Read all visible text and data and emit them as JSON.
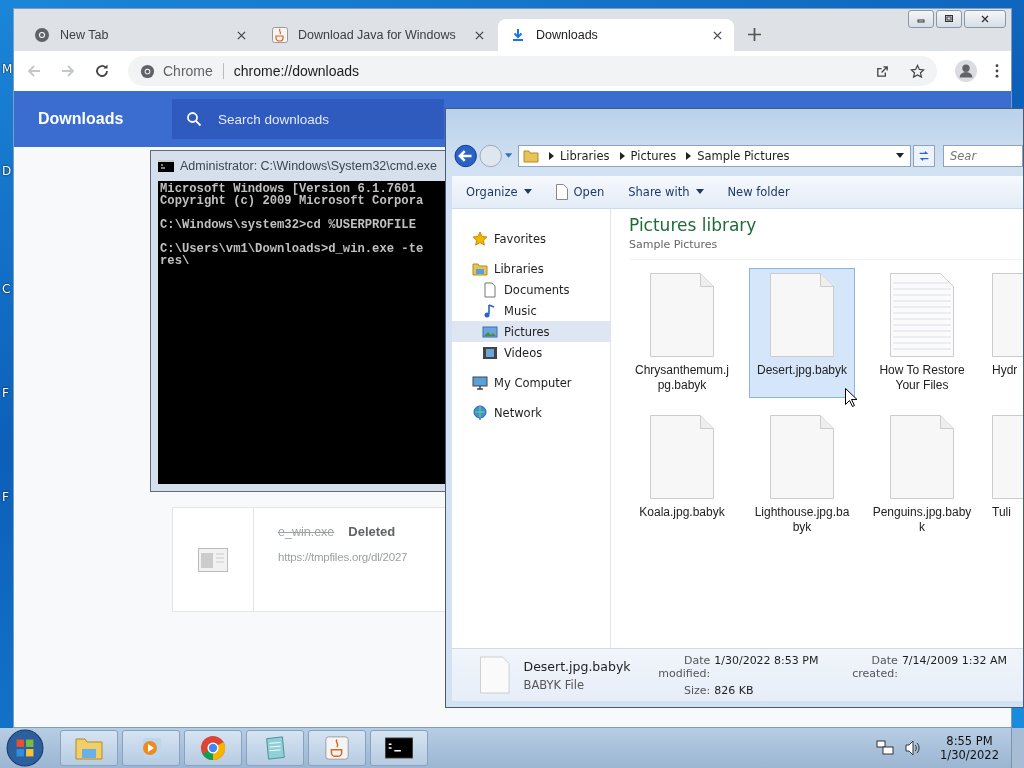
{
  "desktop": {
    "icon_labels": [
      "M",
      "D",
      "C",
      "F",
      "F"
    ]
  },
  "browser": {
    "tabs": [
      {
        "title": "New Tab",
        "kind": "chrome",
        "selected": false
      },
      {
        "title": "Download Java for Windows",
        "kind": "java",
        "selected": false
      },
      {
        "title": "Downloads",
        "kind": "download",
        "selected": true
      }
    ],
    "address": {
      "site": "Chrome",
      "url": "chrome://downloads"
    },
    "page": {
      "title": "Downloads",
      "search": {
        "placeholder": "Search downloads"
      },
      "items": [
        {
          "name": "e_win.exe",
          "deleted": true,
          "status": "Deleted",
          "url": "https://tmpfiles.org/dl/2027"
        }
      ]
    }
  },
  "console": {
    "title": "Administrator: C:\\Windows\\System32\\cmd.exe",
    "blocks": [
      [
        "Microsoft Windows [Version 6.1.7601",
        "Copyright (c) 2009 Microsoft Corpora"
      ],
      [
        "C:\\Windows\\system32>cd %USERPROFILE"
      ],
      [
        "C:\\Users\\vm1\\Downloads>d_win.exe -te",
        "res\\"
      ]
    ]
  },
  "explorer": {
    "breadcrumbs": [
      "Libraries",
      "Pictures",
      "Sample Pictures"
    ],
    "search": {
      "placeholder": "Sear"
    },
    "toolbar": [
      {
        "label": "Organize",
        "kind": "menu"
      },
      {
        "label": "Open",
        "kind": "open"
      },
      {
        "label": "Share with",
        "kind": "menu"
      },
      {
        "label": "New folder",
        "kind": "plain"
      }
    ],
    "nav": [
      {
        "label": "Favorites",
        "kind": "star",
        "selected": false
      },
      {
        "label": "Libraries",
        "kind": "library",
        "selected": false,
        "children": [
          {
            "label": "Documents",
            "kind": "documents",
            "selected": false
          },
          {
            "label": "Music",
            "kind": "music",
            "selected": false
          },
          {
            "label": "Pictures",
            "kind": "pictures",
            "selected": true
          },
          {
            "label": "Videos",
            "kind": "videos",
            "selected": false
          }
        ]
      },
      {
        "label": "My Computer",
        "kind": "computer",
        "selected": false
      },
      {
        "label": "Network",
        "kind": "network",
        "selected": false
      }
    ],
    "heading": "Pictures library",
    "subheading": "Sample Pictures",
    "files": [
      {
        "name": "Chrysanthemum.jpg.babyk",
        "kind": "blank",
        "selected": false
      },
      {
        "name": "Desert.jpg.babyk",
        "kind": "blank",
        "selected": true
      },
      {
        "name": "How To Restore Your Files",
        "kind": "text",
        "selected": false
      },
      {
        "name": "Hydr",
        "kind": "blank",
        "selected": false
      },
      {
        "name": "Koala.jpg.babyk",
        "kind": "blank",
        "selected": false
      },
      {
        "name": "Lighthouse.jpg.babyk",
        "kind": "blank",
        "selected": false
      },
      {
        "name": "Penguins.jpg.babyk",
        "kind": "blank",
        "selected": false
      },
      {
        "name": "Tuli",
        "kind": "blank",
        "selected": false
      }
    ],
    "details": {
      "name": "Desert.jpg.babyk",
      "type": "BABYK File",
      "fields": [
        {
          "label": "Date modified:",
          "value": "1/30/2022 8:53 PM"
        },
        {
          "label": "Size:",
          "value": "826 KB"
        },
        {
          "label": "Date created:",
          "value": "7/14/2009 1:32 AM"
        }
      ]
    }
  },
  "taskbar": {
    "apps": [
      {
        "kind": "folder"
      },
      {
        "kind": "media"
      },
      {
        "kind": "chrome"
      },
      {
        "kind": "notepad"
      },
      {
        "kind": "java"
      },
      {
        "kind": "console"
      }
    ],
    "clock": {
      "time": "8:55 PM",
      "date": "1/30/2022"
    }
  }
}
